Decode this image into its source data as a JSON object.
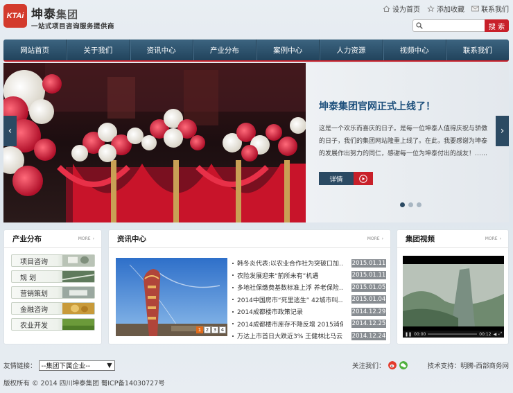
{
  "logo": {
    "badge": "KTAi",
    "name_bold": "坤泰",
    "name_light": "集团",
    "tagline": "一站式项目咨询服务提供商"
  },
  "top_links": [
    {
      "label": "设为首页",
      "icon": "home-icon"
    },
    {
      "label": "添加收藏",
      "icon": "star-icon"
    },
    {
      "label": "联系我们",
      "icon": "mail-icon"
    }
  ],
  "search": {
    "placeholder": "",
    "button": "搜 索",
    "icon": "search-icon"
  },
  "nav": [
    "网站首页",
    "关于我们",
    "资讯中心",
    "产业分布",
    "案例中心",
    "人力资源",
    "视频中心",
    "联系我们"
  ],
  "slider": {
    "title": "坤泰集团官网正式上线了！",
    "body": "这是一个欢乐而喜庆的日子。是每一位坤泰人值得庆祝与骄傲的日子，我们的集团网站隆重上线了。在此，我要感谢为坤泰的发展作出努力的同仁，感谢每一位为坤泰付出的战友！……",
    "button": "详情",
    "prev": "‹",
    "next": "›",
    "active_dot": 1
  },
  "industry": {
    "title": "产业分布",
    "more": "MORE",
    "items": [
      "项目咨询",
      "规 划",
      "营销策划",
      "金融咨询",
      "农业开发"
    ]
  },
  "news": {
    "title": "资讯中心",
    "more": "MORE",
    "pager": [
      "1",
      "2",
      "3",
      "4"
    ],
    "active_page": "1",
    "items": [
      {
        "title": "韩冬炎代表:以农业合作社为突破口加…",
        "date": "2015.01.11"
      },
      {
        "title": "农险发展迎来“前所未有”机遇",
        "date": "2015.01.11"
      },
      {
        "title": "多地社保缴费基数标准上浮 养老保险…",
        "date": "2015.01.05"
      },
      {
        "title": "2014中国房市“死里逃生” 42城市叫…",
        "date": "2015.01.04"
      },
      {
        "title": "2014成都楼市政策记录",
        "date": "2014.12.29"
      },
      {
        "title": "2014成都楼市库存不降反增 2015消化…",
        "date": "2014.12.25"
      },
      {
        "title": "万达上市首日大跌近3% 王健林比马云…",
        "date": "2014.12.24"
      }
    ]
  },
  "video": {
    "title": "集团视频",
    "more": "MORE",
    "time_current": "00:00",
    "time_total": "00:12"
  },
  "footer": {
    "links_label": "友情链接：",
    "select_value": "--集团下属企业--",
    "follow_label": "关注我们：",
    "support": "技术支持：明腾-西部商务网",
    "copyright": "版权所有 © 2014 四川坤泰集团 蜀ICP备14030727号"
  }
}
